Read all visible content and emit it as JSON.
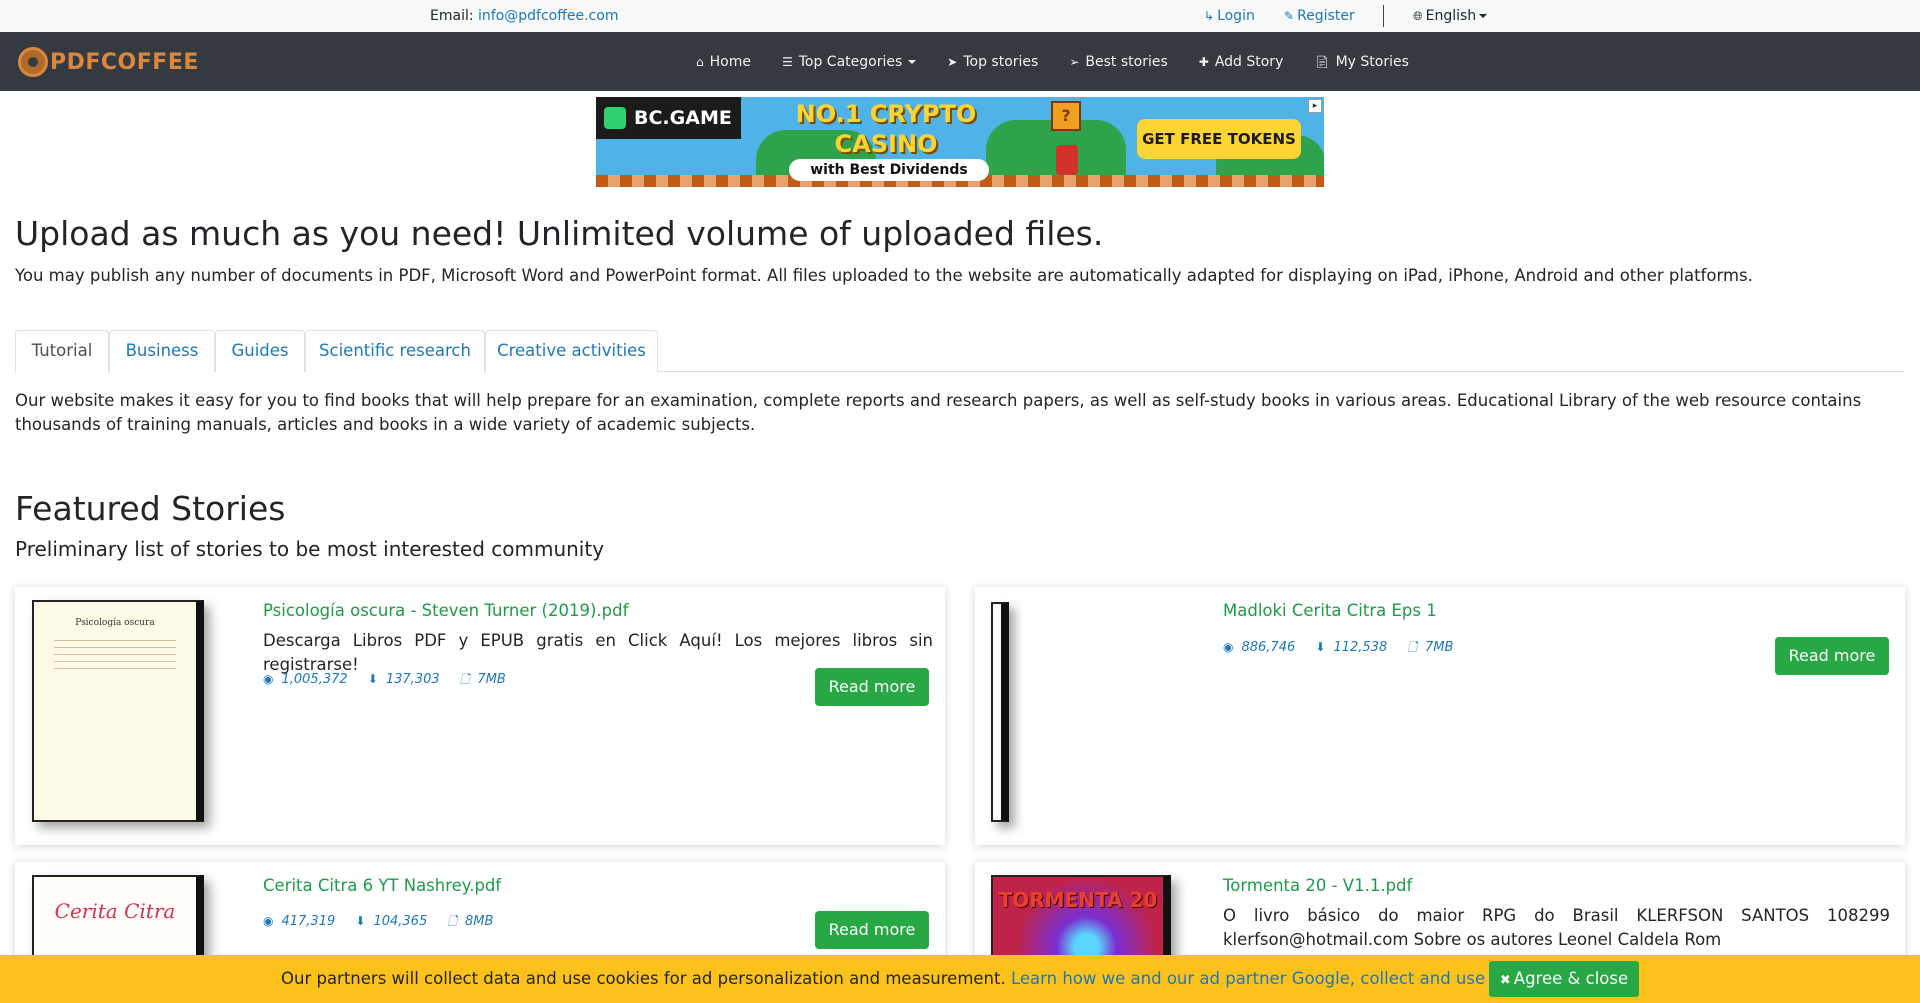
{
  "topbar": {
    "email_label": "Email:",
    "email_value": "info@pdfcoffee.com",
    "login": "Login",
    "register": "Register",
    "language": "English"
  },
  "navbar": {
    "logo": "PDFCOFFEE",
    "items": [
      {
        "label": "Home",
        "icon": "home-icon"
      },
      {
        "label": "Top Categories",
        "icon": "list-icon"
      },
      {
        "label": "Top stories",
        "icon": "paper-plane-icon"
      },
      {
        "label": "Best stories",
        "icon": "paper-plane-outline-icon"
      },
      {
        "label": "Add Story",
        "icon": "plus-icon"
      },
      {
        "label": "My Stories",
        "icon": "file-icon"
      }
    ]
  },
  "ad": {
    "brand": "BC.GAME",
    "headline_line1": "NO.1 CRYPTO",
    "headline_line2": "CASINO",
    "sub": "with Best Dividends",
    "cta": "GET FREE TOKENS"
  },
  "hero": {
    "title": "Upload as much as you need! Unlimited volume of uploaded files.",
    "text": "You may publish any number of documents in PDF, Microsoft Word and PowerPoint format. All files uploaded to the website are automatically adapted for displaying on iPad, iPhone, Android and other platforms."
  },
  "tabs": {
    "items": [
      "Tutorial",
      "Business",
      "Guides",
      "Scientific research",
      "Creative activities"
    ],
    "active": "Tutorial",
    "description": "Our website makes it easy for you to find books that will help prepare for an examination, complete reports and research papers, as well as self-study books in various areas. Educational Library of the web resource contains thousands of training manuals, articles and books in a wide variety of academic subjects."
  },
  "featured": {
    "title": "Featured Stories",
    "subtitle": "Preliminary list of stories to be most interested community",
    "read_more": "Read more",
    "stories": [
      {
        "title": "Psicología oscura - Steven Turner (2019).pdf",
        "description": "Descarga Libros PDF y EPUB gratis en Click Aquí! Los mejores libros sin registrarse!",
        "views": "1,005,372",
        "downloads": "137,303",
        "size": "7MB",
        "cover_title": "Psicología oscura"
      },
      {
        "title": "Madloki Cerita Citra Eps 1",
        "description": "",
        "views": "886,746",
        "downloads": "112,538",
        "size": "7MB"
      },
      {
        "title": "Cerita Citra 6 YT Nashrey.pdf",
        "description": "",
        "views": "417,319",
        "downloads": "104,365",
        "size": "8MB",
        "cover_title": "Cerita Citra"
      },
      {
        "title": "Tormenta 20 - V1.1.pdf",
        "description": "O livro básico do maior RPG do Brasil KLERFSON SANTOS 108299 klerfson@hotmail.com Sobre os autores Leonel Caldela Rom",
        "views": "",
        "downloads": "",
        "size": "",
        "cover_title": "TORMENTA 20"
      }
    ]
  },
  "cookie": {
    "message": "Our partners will collect data and use cookies for ad personalization and measurement.",
    "link": "Learn how we and our ad partner Google, collect and use data.",
    "agree": "Agree & close"
  }
}
